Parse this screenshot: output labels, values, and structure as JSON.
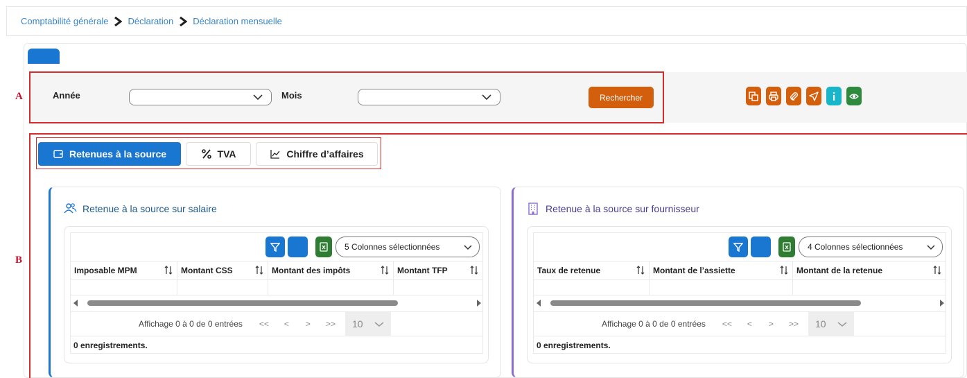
{
  "breadcrumb": [
    "Comptabilité générale",
    "Déclaration",
    "Déclaration mensuelle"
  ],
  "annotations": {
    "a": "A",
    "b": "B"
  },
  "filters": {
    "annee_label": "Année",
    "annee_value": "",
    "mois_label": "Mois",
    "mois_value": "",
    "search_label": "Rechercher"
  },
  "action_icons": [
    {
      "name": "export-icon",
      "color": "#d35f0c"
    },
    {
      "name": "print-icon",
      "color": "#d35f0c"
    },
    {
      "name": "attach-icon",
      "color": "#d35f0c"
    },
    {
      "name": "send-icon",
      "color": "#d35f0c"
    },
    {
      "name": "info-icon",
      "color": "#19b6c9"
    },
    {
      "name": "eye-icon",
      "color": "#2e8b3e"
    }
  ],
  "tabs": [
    {
      "label": "Retenues à la source",
      "active": true,
      "icon": "wallet-icon"
    },
    {
      "label": "TVA",
      "active": false,
      "icon": "percent-icon"
    },
    {
      "label": "Chiffre d’affaires",
      "active": false,
      "icon": "chart-icon"
    }
  ],
  "colors": {
    "primary": "#1977d2",
    "orange": "#d35f0c",
    "green": "#2e7d32",
    "purple": "#8c6bd3",
    "annotation": "#c8102e"
  },
  "panels": {
    "salaire": {
      "title": "Retenue à la source sur salaire",
      "columns_selected": "5 Colonnes sélectionnées",
      "headers": [
        "Imposable MPM",
        "Montant CSS",
        "Montant des impôts",
        "Montant TFP"
      ],
      "pager_info": "Affichage 0 à 0 de 0 entrées",
      "page_size": "10",
      "count": "0 enregistrements."
    },
    "fournisseur": {
      "title": "Retenue à la source sur fournisseur",
      "columns_selected": "4 Colonnes sélectionnées",
      "headers": [
        "Taux de retenue",
        "Montant de l’assiette",
        "Montant de la retenue"
      ],
      "pager_info": "Affichage 0 à 0 de 0 entrées",
      "page_size": "10",
      "count": "0 enregistrements."
    }
  },
  "pager_glyphs": {
    "first": "<<",
    "prev": "<",
    "next": ">",
    "last": ">>"
  }
}
